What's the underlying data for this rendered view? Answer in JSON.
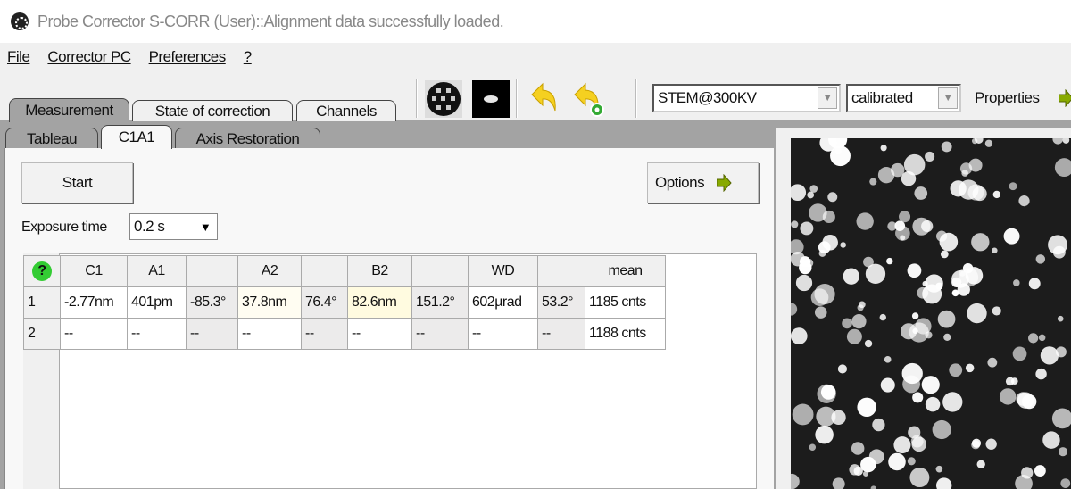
{
  "window": {
    "title": "Probe Corrector S-CORR (User)::Alignment data successfully loaded."
  },
  "menu": [
    "File",
    "Corrector PC",
    "Preferences",
    "?"
  ],
  "tabs_top": [
    "Measurement",
    "State of correction",
    "Channels"
  ],
  "tabs_sub": [
    "Tableau",
    "C1A1",
    "Axis Restoration"
  ],
  "toolbar": {
    "mode": "STEM@300KV",
    "calibration": "calibrated",
    "properties_label": "Properties",
    "icons": [
      "ronchigram-icon",
      "probe-image-icon",
      "undo-icon",
      "undo-add-icon",
      "arrow-right-icon"
    ]
  },
  "controls": {
    "start_label": "Start",
    "options_label": "Options",
    "exposure_label": "Exposure time",
    "exposure_value": "0.2 s"
  },
  "table": {
    "headers": [
      "?",
      "C1",
      "A1",
      "",
      "A2",
      "",
      "B2",
      "",
      "WD",
      "",
      "mean"
    ],
    "rows": [
      [
        "1",
        "-2.77nm",
        "401pm",
        "-85.3°",
        "37.8nm",
        "76.4°",
        "82.6nm",
        "151.2°",
        "602µrad",
        "53.2°",
        "1185 cnts"
      ],
      [
        "2",
        "--",
        "--",
        "--",
        "--",
        "--",
        "--",
        "--",
        "--",
        "--",
        "1188 cnts"
      ]
    ]
  },
  "colors": {
    "help_icon": "#33cc33",
    "arrow_icon": "#88aa00",
    "highlight_cell": "#fffbe0",
    "panel_bg": "#a3a3a3"
  }
}
